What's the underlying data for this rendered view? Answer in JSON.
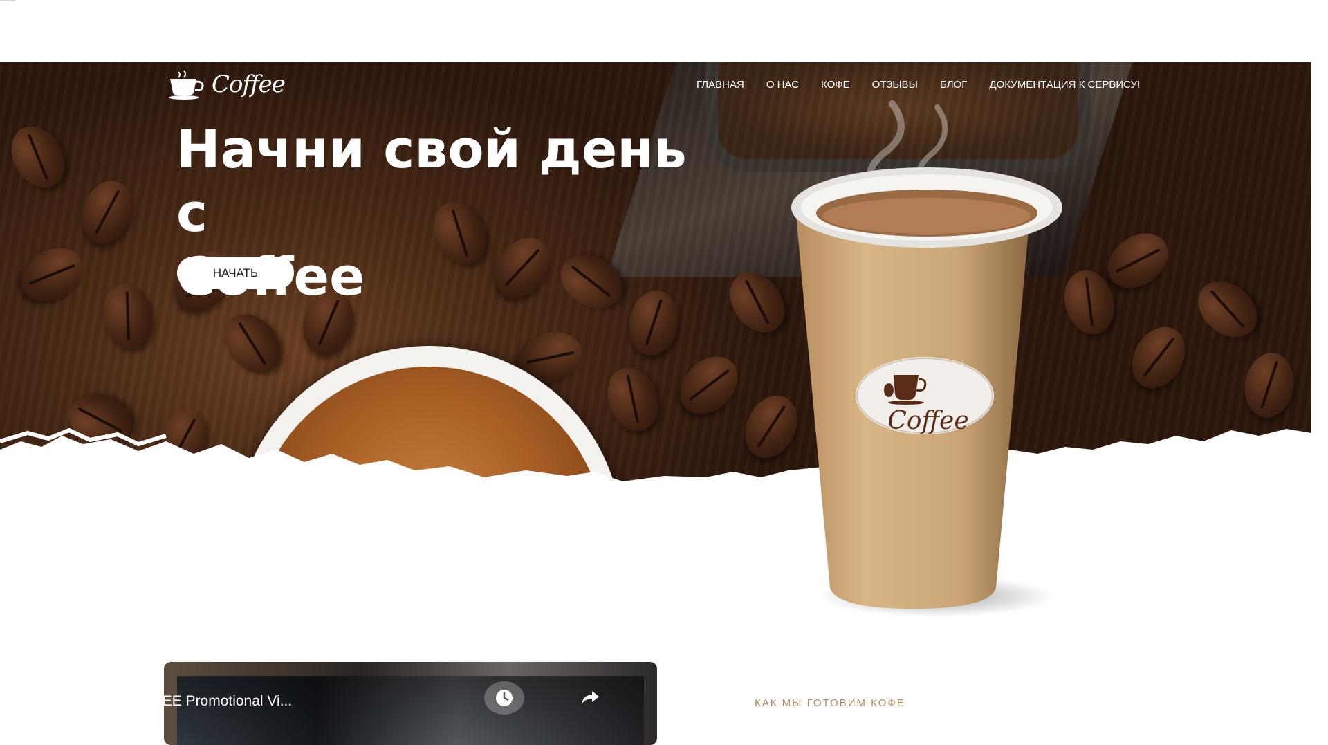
{
  "brand": {
    "logo_text": "Coffee"
  },
  "nav": {
    "items": [
      {
        "label": "ГЛАВНАЯ"
      },
      {
        "label": "О НАС"
      },
      {
        "label": "КОФЕ"
      },
      {
        "label": "ОТЗЫВЫ"
      },
      {
        "label": "БЛОГ"
      },
      {
        "label": "ДОКУМЕНТАЦИЯ К СЕРВИСУ!"
      }
    ]
  },
  "hero": {
    "title_line1": "Начни свой день с",
    "title_line2": "Coffee",
    "cta_label": "НАЧАТЬ",
    "cup_logo_text": "Coffee"
  },
  "video": {
    "title": "BOMBA COFFEE Promotional Vi...",
    "icons": [
      "clock-icon",
      "share-icon"
    ]
  },
  "about": {
    "section_label": "КАК МЫ ГОТОВИМ КОФЕ"
  },
  "colors": {
    "accent": "#b38a5c",
    "hero_dark": "#2c170b",
    "cup": "#c9a577",
    "text_light": "#ffffff"
  }
}
